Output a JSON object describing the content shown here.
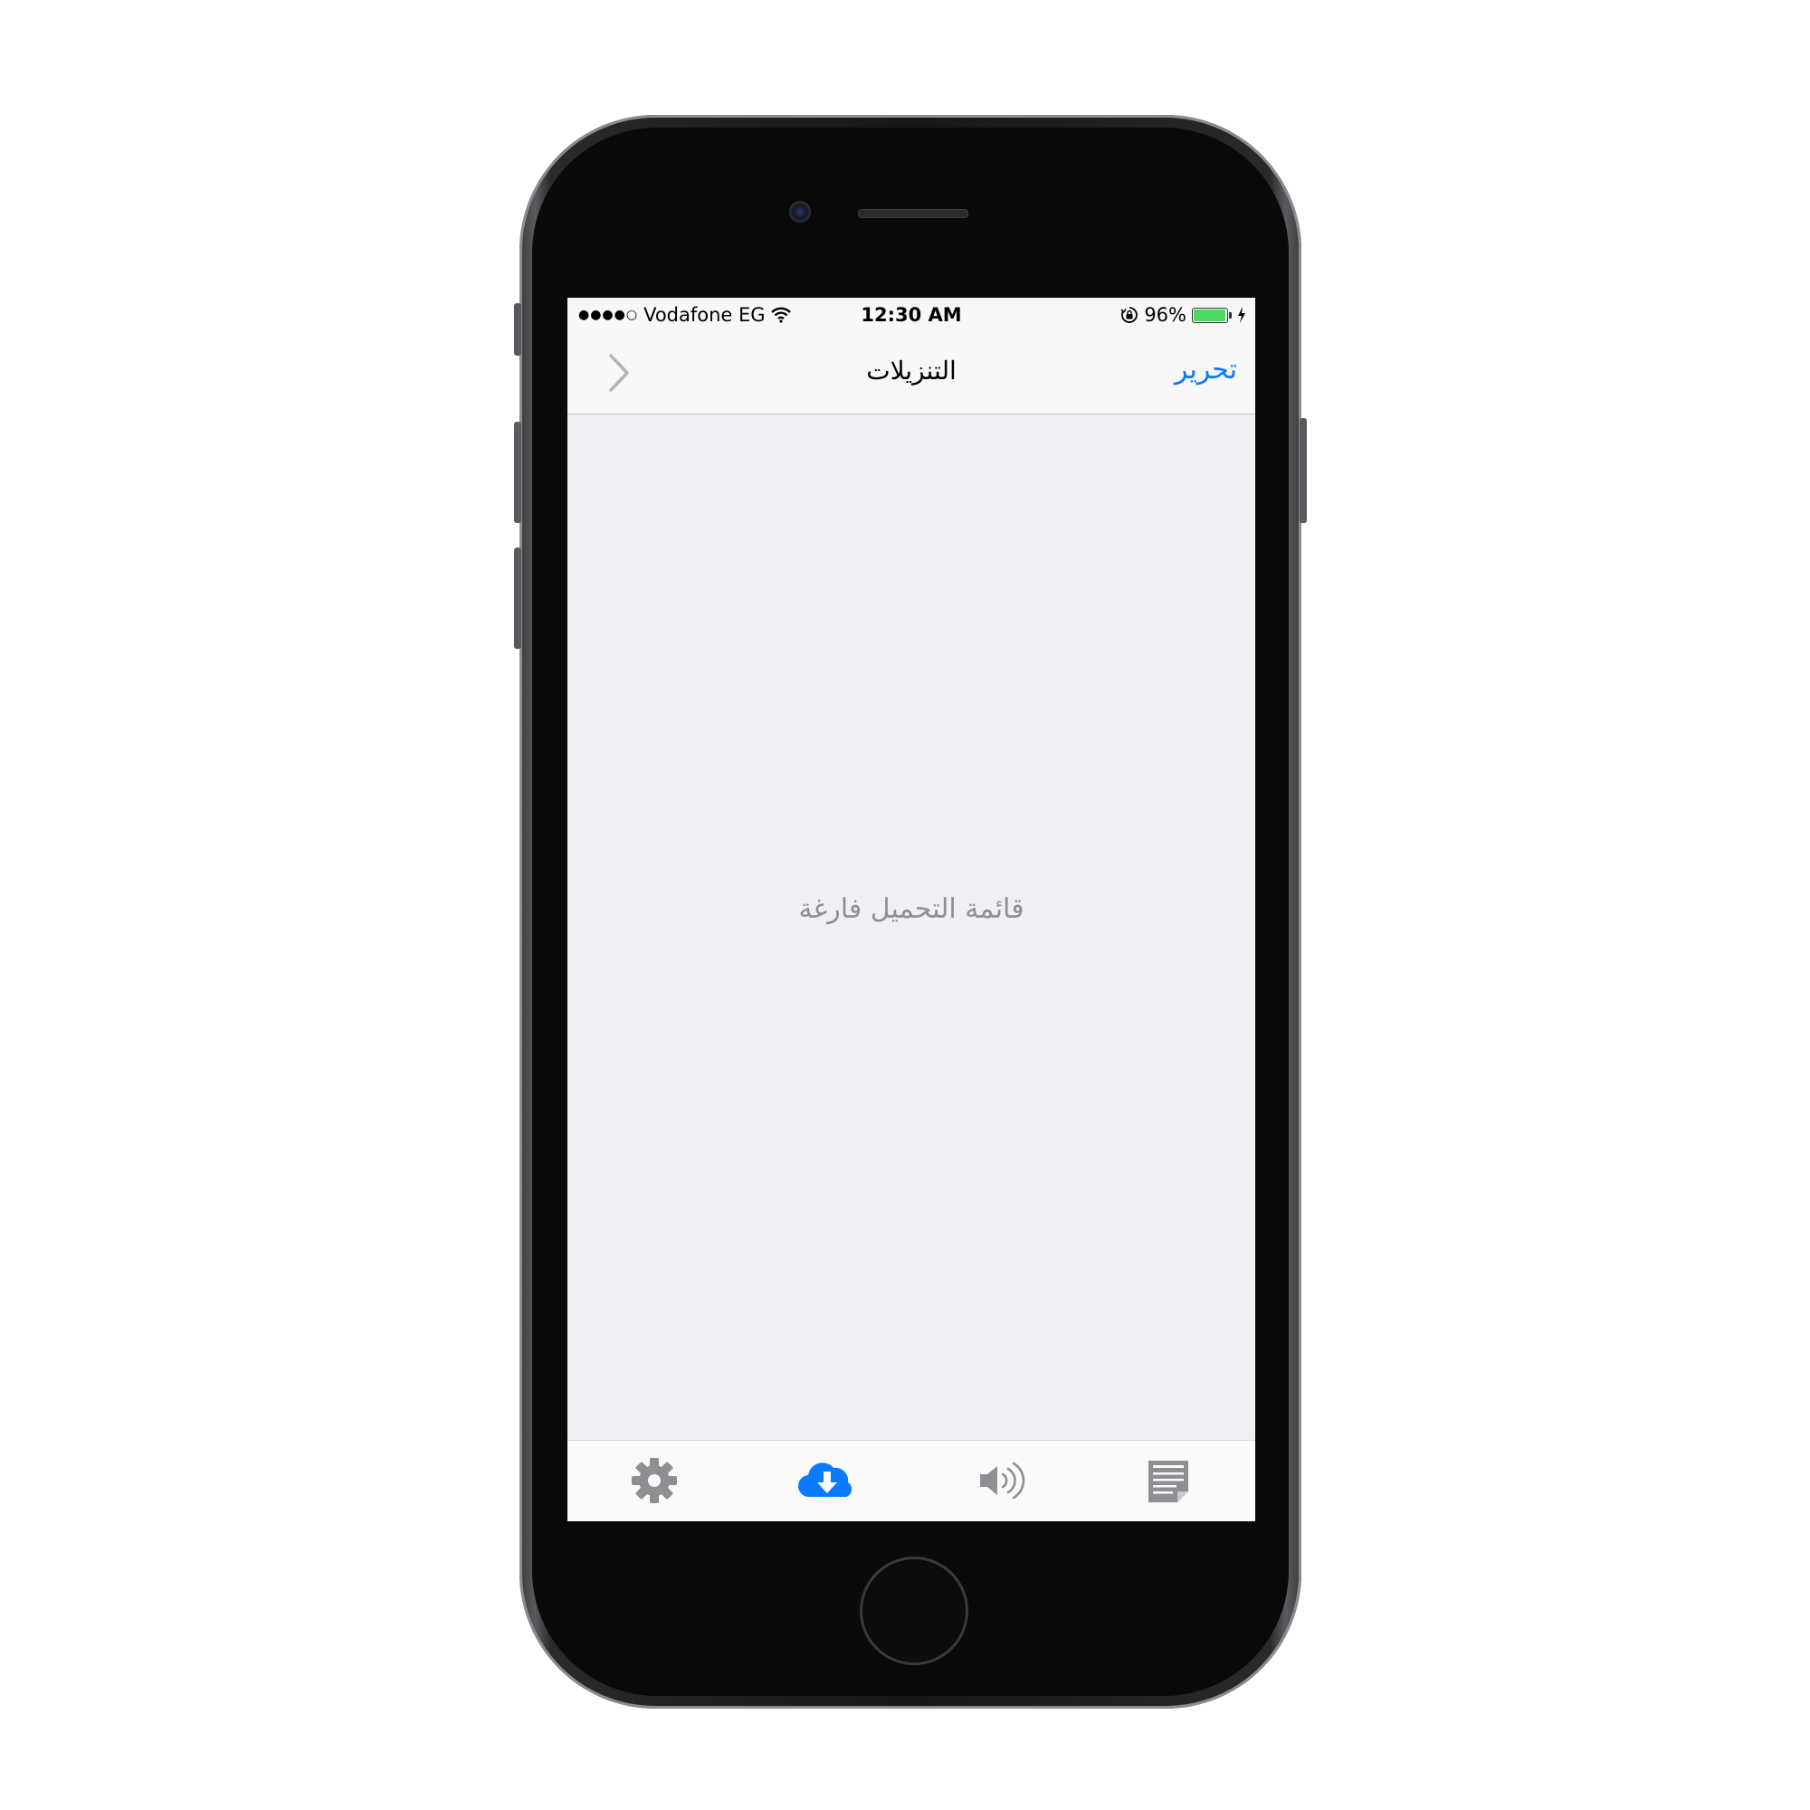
{
  "statusbar": {
    "signal": "●●●●○",
    "carrier": "Vodafone EG",
    "time": "12:30 AM",
    "battery_percent": "96%",
    "battery_level": 0.96,
    "battery_color": "#4cd964"
  },
  "navbar": {
    "title": "التنزيلات",
    "edit_label": "تحرير",
    "back_icon": "chevron-right-icon"
  },
  "main": {
    "empty_message": "قائمة التحميل فارغة"
  },
  "tabbar": {
    "tabs": [
      {
        "icon": "gear-icon",
        "active": false
      },
      {
        "icon": "cloud-download-icon",
        "active": true
      },
      {
        "icon": "speaker-icon",
        "active": false
      },
      {
        "icon": "notes-icon",
        "active": false
      }
    ],
    "active_color": "#0a7aff",
    "inactive_color": "#8e8e93"
  }
}
